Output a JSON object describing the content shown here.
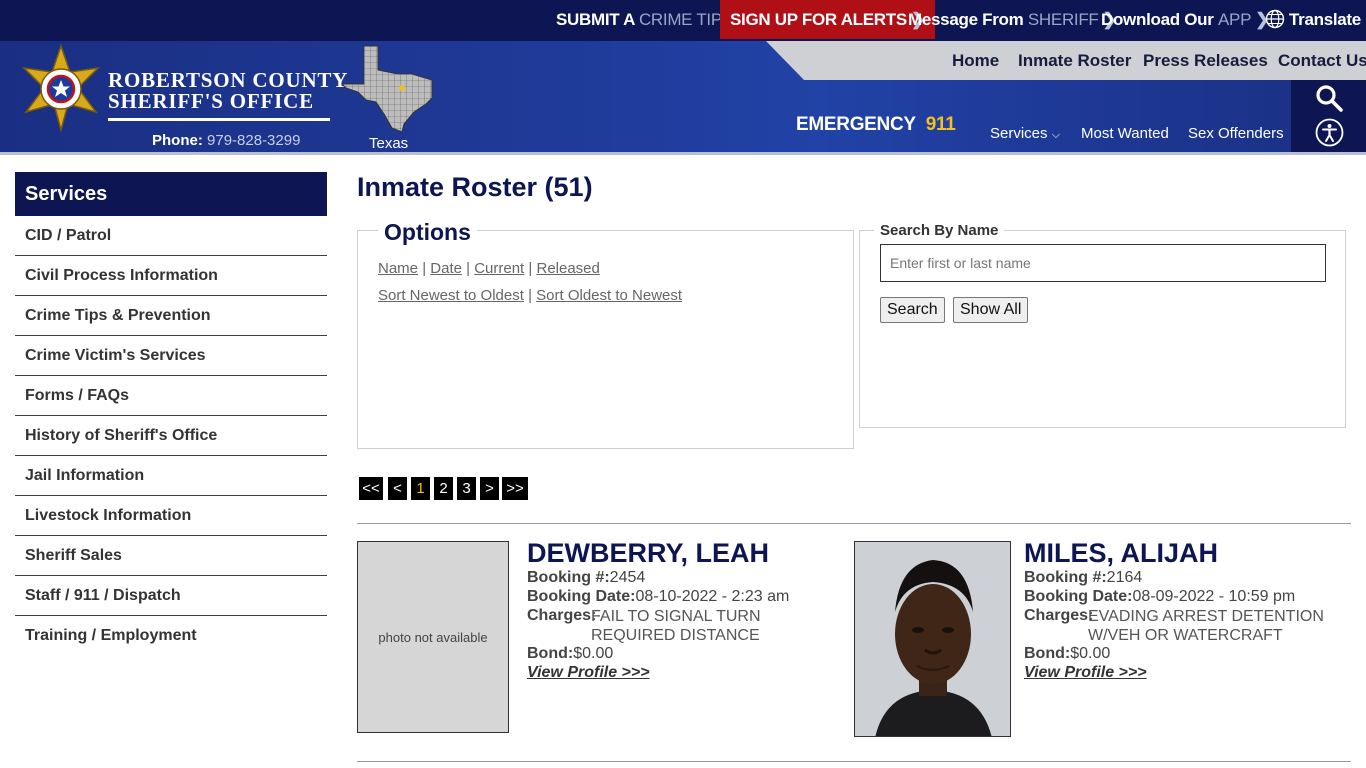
{
  "topbar": {
    "submit_a": "SUBMIT A",
    "crime_tip": "CRIME TIP",
    "alerts": "SIGN UP FOR ALERTS",
    "message_from": "Message From",
    "sheriff": "SHERIFF",
    "download_our": "Download Our",
    "app": "APP",
    "translate": "Translate"
  },
  "header": {
    "org_line1": "ROBERTSON COUNTY",
    "org_line2": "SHERIFF'S OFFICE",
    "phone_label": "Phone:",
    "phone_number": "979-828-3299",
    "state_label": "Texas",
    "emergency_label": "EMERGENCY",
    "emergency_number": "911",
    "colors": {
      "navy": "#0d1552",
      "blue": "#1f3a98",
      "alert_red": "#b00f16",
      "gold": "#f2c21b"
    }
  },
  "nav_primary": [
    "Home",
    "Inmate Roster",
    "Press Releases",
    "Contact Us"
  ],
  "nav_secondary": {
    "services": "Services",
    "most_wanted": "Most Wanted",
    "sex_offenders": "Sex Offenders"
  },
  "icons": {
    "search": "search-icon",
    "accessibility": "accessibility-icon",
    "globe": "globe-icon",
    "badge": "sheriff-star-badge",
    "map": "texas-map"
  },
  "sidebar": {
    "title": "Services",
    "items": [
      "CID / Patrol",
      "Civil Process Information",
      "Crime Tips & Prevention",
      "Crime Victim's Services",
      "Forms / FAQs",
      "History of Sheriff's Office",
      "Jail Information",
      "Livestock Information",
      "Sheriff Sales",
      "Staff / 911 / Dispatch",
      "Training / Employment"
    ]
  },
  "main": {
    "title": "Inmate Roster (51)",
    "options": {
      "legend": "Options",
      "filters": [
        "Name",
        "Date",
        "Current",
        "Released"
      ],
      "sorts": [
        "Sort Newest to Oldest",
        "Sort Oldest to Newest"
      ],
      "separator": "|"
    },
    "search": {
      "legend": "Search By Name",
      "placeholder": "Enter first or last name",
      "search_button": "Search",
      "show_all_button": "Show All"
    },
    "pager": {
      "first": "<<",
      "prev": "<",
      "pages": [
        "1",
        "2",
        "3"
      ],
      "current": "1",
      "next": ">",
      "last": ">>"
    },
    "labels": {
      "booking_no": "Booking #:",
      "booking_date": "Booking Date:",
      "charges": "Charges:",
      "bond": "Bond:",
      "view_profile": "View Profile >>>",
      "no_photo": "photo not available"
    },
    "inmates": [
      {
        "name": "DEWBERRY, LEAH",
        "booking_no": "2454",
        "booking_date": "08-10-2022 - 2:23 am",
        "charges": "FAIL TO SIGNAL TURN REQUIRED DISTANCE",
        "bond": "$0.00",
        "has_photo": false
      },
      {
        "name": "MILES, ALIJAH",
        "booking_no": "2164",
        "booking_date": "08-09-2022 - 10:59 pm",
        "charges": "EVADING ARREST DETENTION W/VEH OR WATERCRAFT",
        "bond": "$0.00",
        "has_photo": true
      }
    ]
  }
}
